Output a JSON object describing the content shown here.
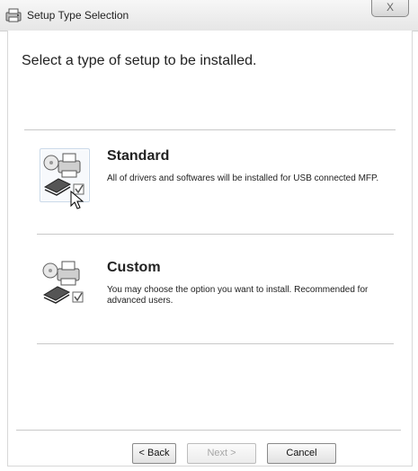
{
  "window": {
    "title": "Setup Type Selection",
    "close_label": "X"
  },
  "heading": "Select a type of setup to be installed.",
  "options": [
    {
      "title": "Standard",
      "description": "All of drivers and softwares will be installed for USB connected MFP."
    },
    {
      "title": "Custom",
      "description": "You may choose the option you want to install. Recommended for advanced users."
    }
  ],
  "footer": {
    "back_label": "< Back",
    "next_label": "Next >",
    "cancel_label": "Cancel"
  }
}
